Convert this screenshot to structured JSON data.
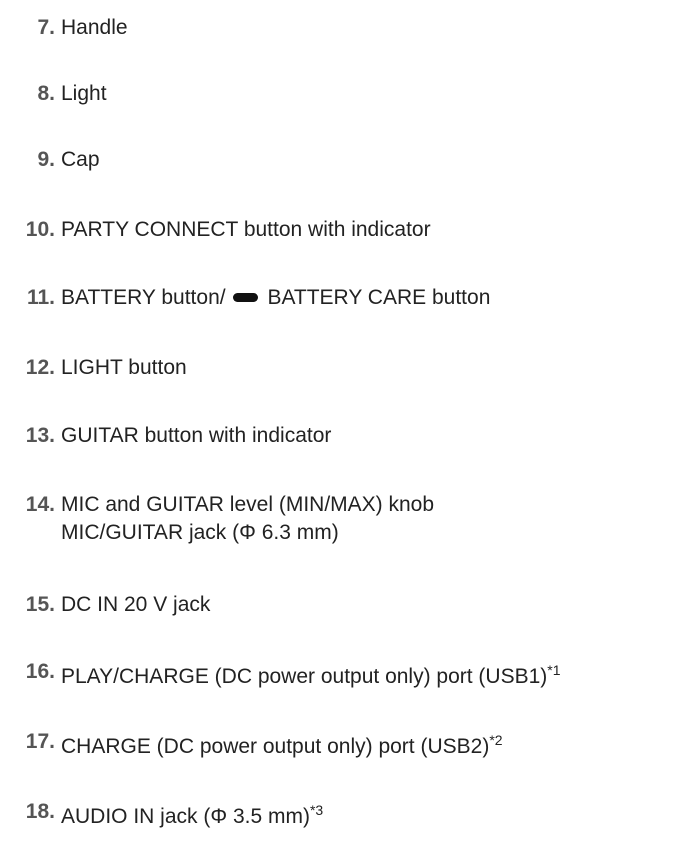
{
  "items": [
    {
      "number": "7.",
      "label": "Handle"
    },
    {
      "number": "8.",
      "label": "Light"
    },
    {
      "number": "9.",
      "label": "Cap"
    },
    {
      "number": "10.",
      "label": "PARTY CONNECT button with indicator"
    },
    {
      "number": "11.",
      "label_before": "BATTERY button/",
      "icon": "minus-bar-icon",
      "label_after": "BATTERY CARE button"
    },
    {
      "number": "12.",
      "label": "LIGHT button"
    },
    {
      "number": "13.",
      "label": "GUITAR button with indicator"
    },
    {
      "number": "14.",
      "label": "MIC and GUITAR level (MIN/MAX) knob",
      "label2": "MIC/GUITAR jack (Φ 6.3 mm)"
    },
    {
      "number": "15.",
      "label": "DC IN 20 V jack"
    },
    {
      "number": "16.",
      "label": "PLAY/CHARGE (DC power output only) port (USB1)",
      "footnote": "*1"
    },
    {
      "number": "17.",
      "label": "CHARGE (DC power output only) port (USB2)",
      "footnote": "*2"
    },
    {
      "number": "18.",
      "label": "AUDIO IN jack (Φ 3.5 mm)",
      "footnote": "*3"
    }
  ]
}
